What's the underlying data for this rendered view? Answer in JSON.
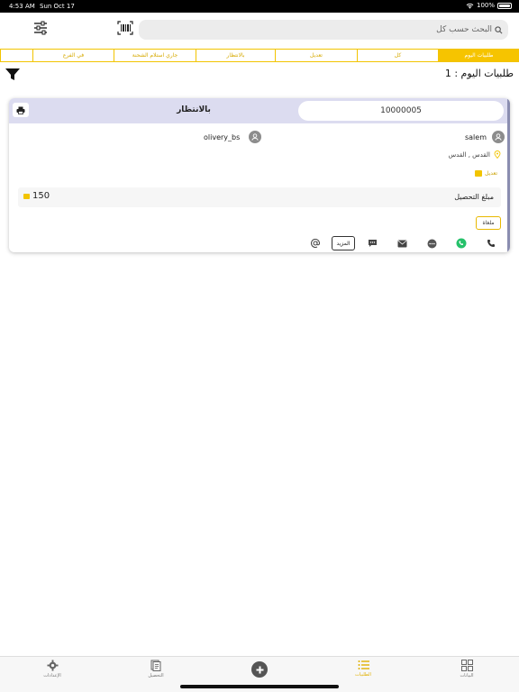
{
  "status_bar": {
    "time": "4:53 AM",
    "date": "Sun Oct 17",
    "battery": "100%"
  },
  "search": {
    "placeholder": "البحث حسب كل"
  },
  "tabs": [
    {
      "label": "في الفرع"
    },
    {
      "label": "جاري استلام الشحنة"
    },
    {
      "label": "بالانتظار"
    },
    {
      "label": "تعديل"
    },
    {
      "label": "كل"
    },
    {
      "label": "طلبيات اليوم"
    }
  ],
  "title": "طلبيات اليوم : 1",
  "order": {
    "status": "بالانتظار",
    "id": "10000005",
    "customer": "salem",
    "driver": "olivery_bs",
    "address": "القدس , القدس",
    "edit_label": "تعديل",
    "amount_label": "مبلغ التحصيل",
    "amount": "150",
    "cancel_label": "ملغاة",
    "more_label": "المزيد"
  },
  "colors": {
    "accent": "#f6c400",
    "card_header": "#dcdcf0",
    "whatsapp": "#25c16a"
  },
  "bottom_nav": {
    "settings": "الإعدادات",
    "collection": "التحصيل",
    "orders": "الطلبيات",
    "dashboard": "البيانات"
  }
}
